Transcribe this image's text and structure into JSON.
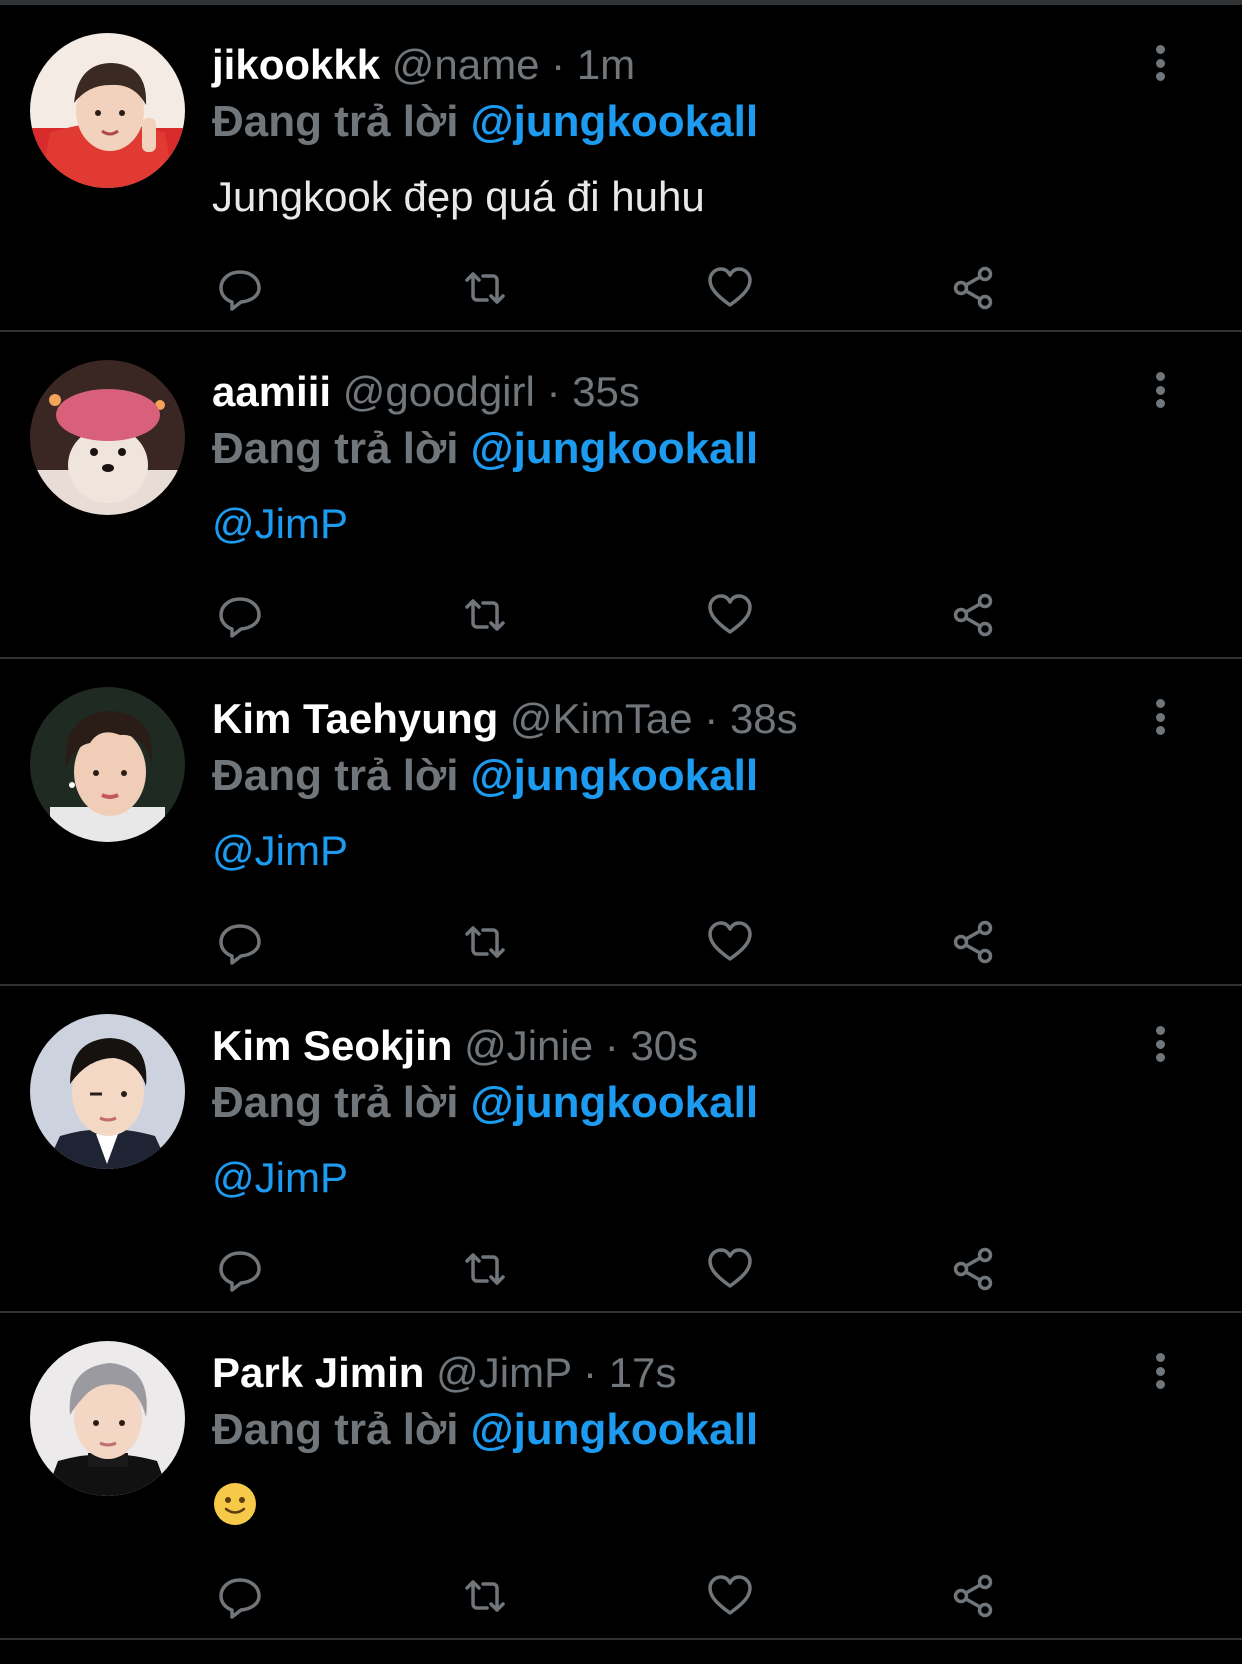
{
  "colors": {
    "background": "#000000",
    "divider": "#2f3336",
    "primary_text": "#ffffff",
    "secondary_text": "#71767b",
    "accent": "#1d9bf0"
  },
  "tweets": [
    {
      "display_name": "jikookkk",
      "handle": "@name",
      "separator": "·",
      "time": "1m",
      "reply_prefix": "Đang trả lời",
      "reply_target": "@jungkookall",
      "body": "Jungkook đẹp quá đi huhu",
      "avatar_icon": "avatar-red-hoodie"
    },
    {
      "display_name": "aamiii",
      "handle": "@goodgirl",
      "separator": "·",
      "time": "35s",
      "reply_prefix": "Đang trả lời",
      "reply_target": "@jungkookall",
      "body": "@JimP",
      "avatar_icon": "avatar-dog-shower-cap"
    },
    {
      "display_name": "Kim Taehyung",
      "handle": "@KimTae",
      "separator": "·",
      "time": "38s",
      "reply_prefix": "Đang trả lời",
      "reply_target": "@jungkookall",
      "body": "@JimP",
      "avatar_icon": "avatar-curly-hair"
    },
    {
      "display_name": "Kim Seokjin",
      "handle": "@Jinie",
      "separator": "·",
      "time": "30s",
      "reply_prefix": "Đang trả lời",
      "reply_target": "@jungkookall",
      "body": "@JimP",
      "avatar_icon": "avatar-suit"
    },
    {
      "display_name": "Park Jimin",
      "handle": "@JimP",
      "separator": "·",
      "time": "17s",
      "reply_prefix": "Đang trả lời",
      "reply_target": "@jungkookall",
      "body_emoji": "slightly-smiling-face-emoji",
      "avatar_icon": "avatar-grey-hair"
    }
  ],
  "action_icons": [
    "reply-icon",
    "retweet-icon",
    "like-icon",
    "share-icon"
  ]
}
